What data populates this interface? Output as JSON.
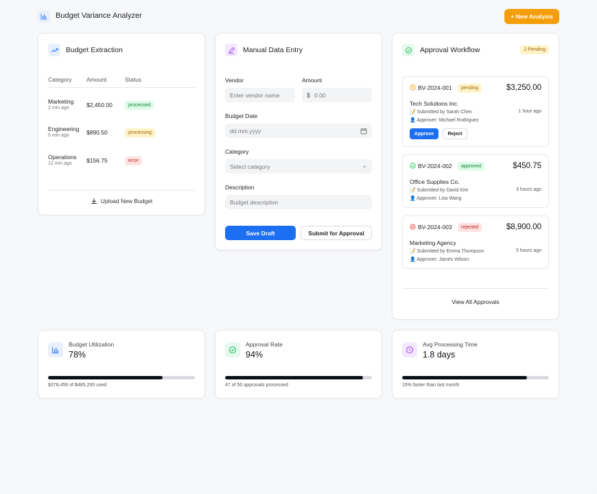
{
  "header": {
    "title": "Budget Variance Analyzer",
    "new_button": "+ New Analysis"
  },
  "extraction": {
    "title": "Budget Extraction",
    "columns": [
      "Category",
      "Amount",
      "Status"
    ],
    "rows": [
      {
        "category": "Marketing",
        "time": "2 min ago",
        "amount": "$2,450.00",
        "status": "processed",
        "status_color": "#15803d"
      },
      {
        "category": "Engineering",
        "time": "5 min ago",
        "amount": "$890.50",
        "status": "processing",
        "status_color": "#a16207"
      },
      {
        "category": "Operations",
        "time": "12 min ago",
        "amount": "$156.75",
        "status": "error",
        "status_color": "#b91c1c"
      }
    ],
    "upload_label": "Upload New Budget"
  },
  "manual": {
    "title": "Manual Data Entry",
    "vendor_label": "Vendor",
    "vendor_placeholder": "Enter vendor name",
    "amount_label": "Amount",
    "amount_prefix": "$",
    "amount_placeholder": "0.00",
    "date_label": "Budget Date",
    "date_placeholder": "dd.mm.yyyy",
    "category_label": "Category",
    "category_placeholder": "Select category",
    "description_label": "Description",
    "description_placeholder": "Budget description",
    "save_label": "Save Draft",
    "submit_label": "Submit for Approval"
  },
  "workflow": {
    "title": "Approval Workflow",
    "pending_badge": "2 Pending",
    "items": [
      {
        "id": "BV-2024-001",
        "status": "pending",
        "amount": "$3,250.00",
        "company": "Tech Solutions Inc.",
        "submitted": "Submitted by Sarah Chen",
        "time": "1 hour ago",
        "approver": "Approver: Michael Rodriguez"
      },
      {
        "id": "BV-2024-002",
        "status": "approved",
        "amount": "$450.75",
        "company": "Office Supplies Co.",
        "submitted": "Submitted by David Kim",
        "time": "3 hours ago",
        "approver": "Approver: Lisa Wang"
      },
      {
        "id": "BV-2024-003",
        "status": "rejected",
        "amount": "$8,900.00",
        "company": "Marketing Agency",
        "submitted": "Submitted by Emma Thompson",
        "time": "5 hours ago",
        "approver": "Approver: James Wilson"
      }
    ],
    "approve_label": "Approve",
    "reject_label": "Reject",
    "view_all": "View All Approvals"
  },
  "stats": {
    "utilization": {
      "label": "Budget Utilization",
      "value": "78%",
      "fraction": 0.78,
      "note": "$378,456 of $485,200 used"
    },
    "approval_rate": {
      "label": "Approval Rate",
      "value": "94%",
      "fraction": 0.94,
      "note": "47 of 50 approvals processed"
    },
    "processing_time": {
      "label": "Avg Processing Time",
      "value": "1.8 days",
      "fraction": 0.85,
      "note": "15% faster than last month"
    }
  },
  "colors": {
    "accent_orange": "#f59e0b",
    "primary_blue": "#1d6ff2",
    "pending": "#f59e0b",
    "approved": "#22c55e",
    "rejected": "#ef4444"
  }
}
